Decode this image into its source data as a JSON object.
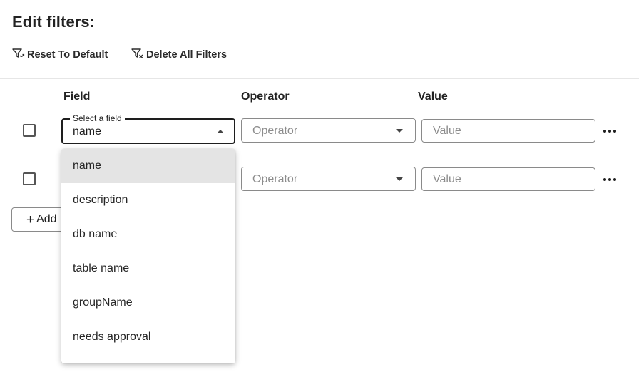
{
  "page": {
    "title": "Edit filters:"
  },
  "toolbar": {
    "reset_label": "Reset To Default",
    "delete_label": "Delete All Filters"
  },
  "table": {
    "headers": {
      "field": "Field",
      "operator": "Operator",
      "value": "Value"
    },
    "rows": [
      {
        "field_legend": "Select a field",
        "field_value": "name",
        "operator_placeholder": "Operator",
        "value_placeholder": "Value"
      },
      {
        "operator_placeholder": "Operator",
        "value_placeholder": "Value"
      }
    ]
  },
  "add_button": {
    "label": "Add"
  },
  "dropdown": {
    "selected_index": 0,
    "options": [
      "name",
      "description",
      "db name",
      "table name",
      "groupName",
      "needs approval"
    ]
  },
  "icons": {
    "reset": "filter-reset-icon",
    "delete": "filter-delete-icon",
    "more": "more-horizontal-icon",
    "add": "plus-icon"
  },
  "colors": {
    "text": "#222222",
    "placeholder": "#8c8c8c",
    "border": "#8a8a8a",
    "selected_option_bg": "#e4e4e4"
  }
}
